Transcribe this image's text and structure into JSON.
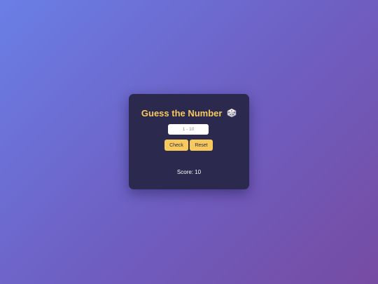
{
  "game": {
    "title": "Guess the Number",
    "title_icon": "dice-icon",
    "input": {
      "placeholder": "1 - 10",
      "value": ""
    },
    "check_label": "Check",
    "reset_label": "Reset",
    "message": "",
    "score_label": "Score: ",
    "score_value": "10"
  },
  "colors": {
    "accent": "#f7c95c",
    "card": "#2b2a4e",
    "gradient_start": "#6a7fe6",
    "gradient_end": "#764ba2"
  }
}
